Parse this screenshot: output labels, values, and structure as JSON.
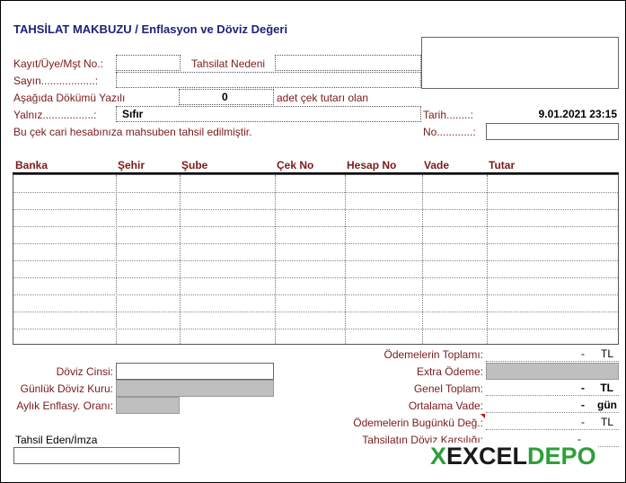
{
  "title": "TAHSİLAT MAKBUZU / Enflasyon ve Döviz Değeri",
  "labels": {
    "kayit": "Kayıt/Üye/Mşt No.:",
    "tahsilat_nedeni": "Tahsilat Nedeni",
    "sayin": "Sayın..................:",
    "asagida": "Aşağıda Dökümü Yazılı",
    "cek_count": "0",
    "adet": "adet çek tutarı olan",
    "yalniz": "Yalnız.................:",
    "yalniz_value": "Sıfır",
    "tarih": "Tarih........:",
    "tarih_value": "9.01.2021 23:15",
    "note": "Bu çek cari hesabınıza mahsuben tahsil edilmiştir.",
    "no": "No............:"
  },
  "table": {
    "headers": [
      "Banka",
      "Şehir",
      "Şube",
      "Çek No",
      "Hesap No",
      "Vade",
      "Tutar"
    ],
    "row_count": 10
  },
  "currency": {
    "doviz_cinsi": "Döviz Cinsi:",
    "gunluk_kur": "Günlük Döviz Kuru:",
    "aylik_enflasyon": "Aylık Enflasy. Oranı:"
  },
  "signature": "Tahsil Eden/İmza",
  "summary": {
    "odemeler_toplami": {
      "label": "Ödemelerin Toplamı:",
      "value": "-",
      "unit": "TL"
    },
    "extra_odeme": {
      "label": "Extra Ödeme:"
    },
    "genel_toplam": {
      "label": "Genel Toplam:",
      "value": "-",
      "unit": "TL"
    },
    "ortalama_vade": {
      "label": "Ortalama Vade:",
      "value": "-",
      "unit": "gün"
    },
    "bugunku_deger": {
      "label": "Ödemelerin Bugünkü Değ.:",
      "value": "-",
      "unit": "TL"
    },
    "doviz_karsiligi": {
      "label": "Tahsilatın Döviz Karşılığı:",
      "value": "-"
    }
  },
  "logo": {
    "text_x": "X",
    "text_excel": "EXCEL",
    "text_depo": "DEPO",
    "color_green": "#2f9e3a",
    "color_dark": "#1a1a1a"
  }
}
